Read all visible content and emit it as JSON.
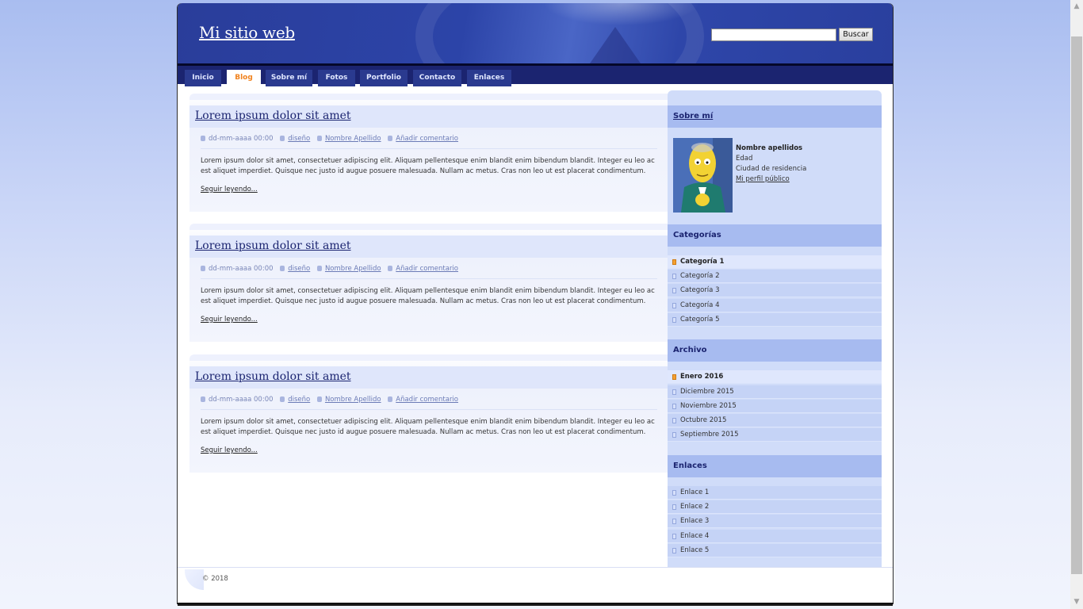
{
  "header": {
    "site_title": "Mi sitio web",
    "search_placeholder": "",
    "search_button": "Buscar"
  },
  "nav": [
    {
      "label": "Inicio"
    },
    {
      "label": "Blog"
    },
    {
      "label": "Sobre mí"
    },
    {
      "label": "Fotos"
    },
    {
      "label": "Portfolio"
    },
    {
      "label": "Contacto"
    },
    {
      "label": "Enlaces"
    }
  ],
  "nav_active": "Blog",
  "posts": [
    {
      "title": "Lorem ipsum dolor sit amet",
      "date": "dd-mm-aaaa 00:00",
      "category": "diseño",
      "author": "Nombre Apellido",
      "comment": "Añadir comentario",
      "body": "Lorem ipsum dolor sit amet, consectetuer adipiscing elit. Aliquam pellentesque enim blandit enim bibendum blandit. Integer eu leo ac est aliquet imperdiet. Quisque nec justo id augue posuere malesuada. Nullam ac metus. Cras non leo ut est placerat condimentum.",
      "more": "Seguir leyendo..."
    },
    {
      "title": "Lorem ipsum dolor sit amet",
      "date": "dd-mm-aaaa 00:00",
      "category": "diseño",
      "author": "Nombre Apellido",
      "comment": "Añadir comentario",
      "body": "Lorem ipsum dolor sit amet, consectetuer adipiscing elit. Aliquam pellentesque enim blandit enim bibendum blandit. Integer eu leo ac est aliquet imperdiet. Quisque nec justo id augue posuere malesuada. Nullam ac metus. Cras non leo ut est placerat condimentum.",
      "more": "Seguir leyendo..."
    },
    {
      "title": "Lorem ipsum dolor sit amet",
      "date": "dd-mm-aaaa 00:00",
      "category": "diseño",
      "author": "Nombre Apellido",
      "comment": "Añadir comentario",
      "body": "Lorem ipsum dolor sit amet, consectetuer adipiscing elit. Aliquam pellentesque enim blandit enim bibendum blandit. Integer eu leo ac est aliquet imperdiet. Quisque nec justo id augue posuere malesuada. Nullam ac metus. Cras non leo ut est placerat condimentum.",
      "more": "Seguir leyendo..."
    }
  ],
  "sidebar": {
    "about": {
      "title": "Sobre mí",
      "name": "Nombre apellidos",
      "age": "Edad",
      "city": "Ciudad de residencia",
      "profile_link": "Mi perfil público"
    },
    "categories": {
      "title": "Categorías",
      "items": [
        "Categoría 1",
        "Categoría 2",
        "Categoría 3",
        "Categoría 4",
        "Categoría 5"
      ]
    },
    "archive": {
      "title": "Archivo",
      "items": [
        "Enero 2016",
        "Diciembre 2015",
        "Noviembre 2015",
        "Octubre 2015",
        "Septiembre 2015"
      ]
    },
    "links": {
      "title": "Enlaces",
      "items": [
        "Enlace 1",
        "Enlace 2",
        "Enlace 3",
        "Enlace 4",
        "Enlace 5"
      ]
    }
  },
  "footer": {
    "copyright": "© 2018"
  },
  "colors": {
    "header_blue": "#2c44a8",
    "nav_dark": "#1b2470",
    "nav_active_text": "#f0821e",
    "sidebar_bg": "#d0dcf9",
    "sidebar_head": "#a7bbf0"
  }
}
